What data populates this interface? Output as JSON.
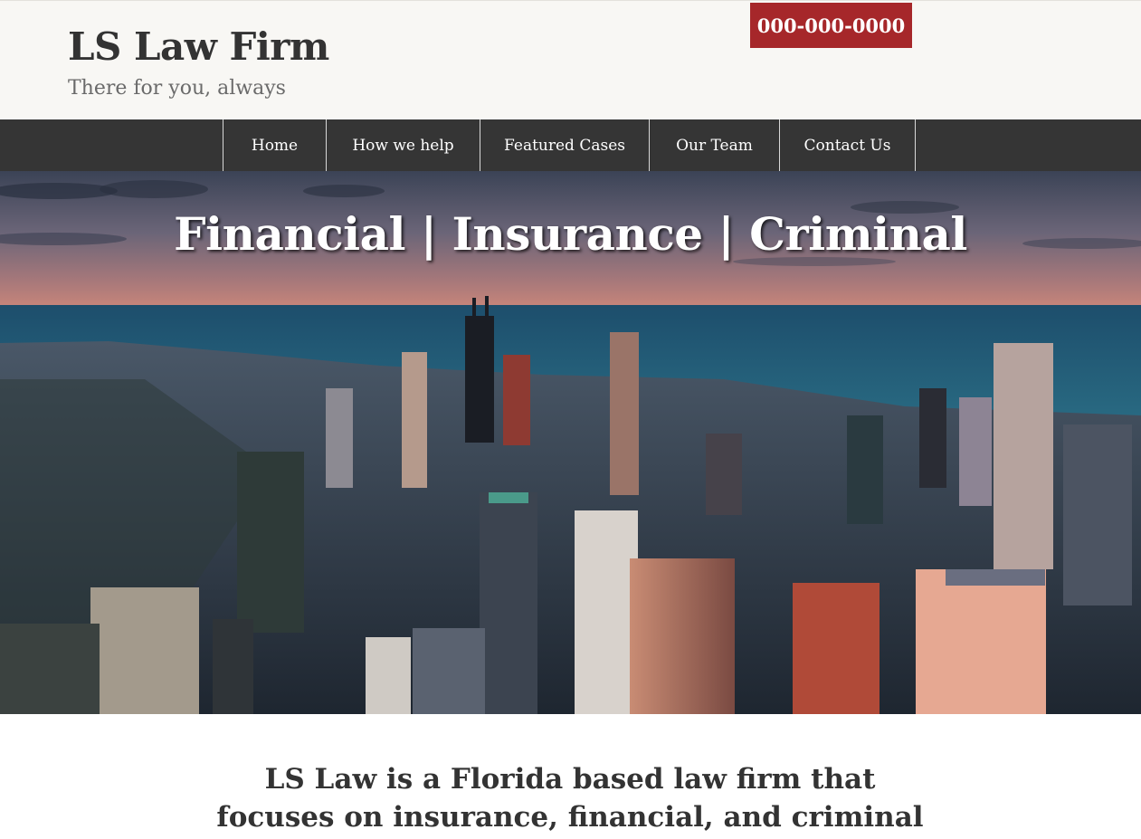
{
  "header": {
    "title": "LS Law Firm",
    "tagline": "There for you, always",
    "phone": "000-000-0000"
  },
  "nav": {
    "items": [
      {
        "label": "Home"
      },
      {
        "label": "How we help"
      },
      {
        "label": "Featured Cases"
      },
      {
        "label": "Our Team"
      },
      {
        "label": "Contact Us"
      }
    ]
  },
  "hero": {
    "title": "Financial | Insurance | Criminal",
    "image": "aerial city skyline at dusk over lake"
  },
  "intro": {
    "line1": "LS Law is a Florida based law firm that",
    "line2": "focuses on insurance, financial, and criminal"
  },
  "colors": {
    "header_bg": "#f8f7f4",
    "nav_bg": "#353535",
    "phone_badge": "#a6272a",
    "text": "#333333"
  }
}
